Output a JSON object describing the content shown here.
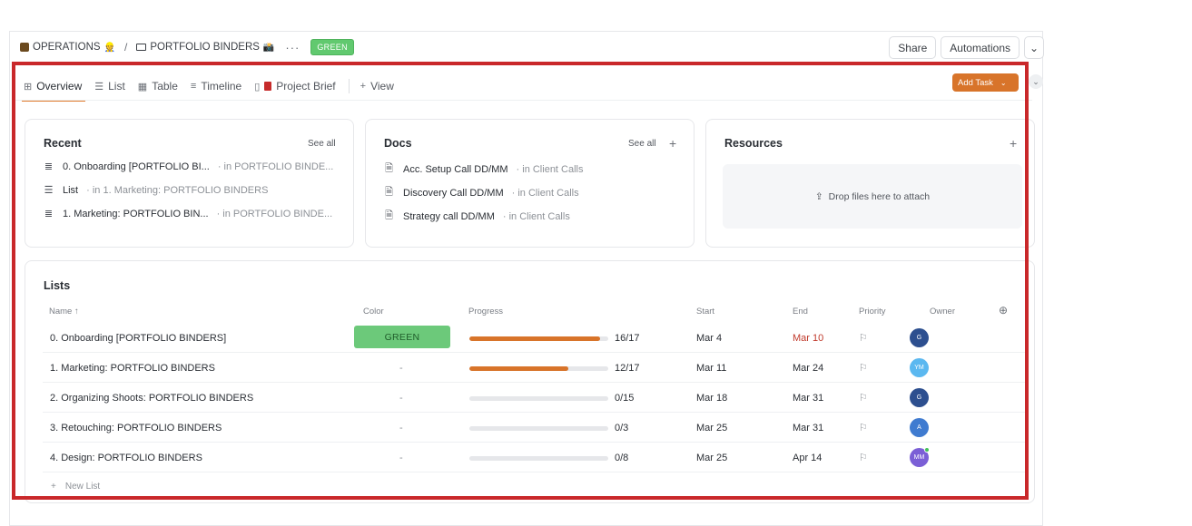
{
  "breadcrumb": {
    "space": "OPERATIONS",
    "space_emoji": "👷",
    "separator": "/",
    "folder": "PORTFOLIO BINDERS",
    "folder_emoji": "📸",
    "more": "···",
    "status": "GREEN"
  },
  "header_actions": {
    "share": "Share",
    "automations": "Automations",
    "chevron": "⌄"
  },
  "tabs": [
    {
      "label": "Overview",
      "icon": "overview-icon",
      "glyph": "⊞"
    },
    {
      "label": "List",
      "icon": "list-icon",
      "glyph": "☰"
    },
    {
      "label": "Table",
      "icon": "table-icon",
      "glyph": "▦"
    },
    {
      "label": "Timeline",
      "icon": "timeline-icon",
      "glyph": "≡"
    },
    {
      "label": "Project Brief",
      "icon": "doc-icon",
      "glyph": "▯"
    },
    {
      "label": "View",
      "icon": "plus-icon",
      "glyph": "+"
    }
  ],
  "add_task": {
    "label": "Add Task",
    "chevron": "⌄"
  },
  "recent": {
    "title": "Recent",
    "see_all": "See all",
    "items": [
      {
        "icon": "doc-lines-icon",
        "glyph": "≣",
        "name": "0. Onboarding [PORTFOLIO BI...",
        "location": "· in PORTFOLIO BINDE..."
      },
      {
        "icon": "list-icon",
        "glyph": "☰",
        "name": "List",
        "location": "· in 1. Marketing: PORTFOLIO BINDERS"
      },
      {
        "icon": "doc-lines-icon",
        "glyph": "≣",
        "name": "1. Marketing: PORTFOLIO BIN...",
        "location": "· in PORTFOLIO BINDE..."
      }
    ]
  },
  "docs": {
    "title": "Docs",
    "see_all": "See all",
    "plus": "+",
    "items": [
      {
        "icon": "doc-icon",
        "glyph": "🗎",
        "name": "Acc. Setup Call DD/MM",
        "location": "· in Client Calls"
      },
      {
        "icon": "doc-icon",
        "glyph": "🗎",
        "name": "Discovery Call DD/MM",
        "location": "· in Client Calls"
      },
      {
        "icon": "doc-icon",
        "glyph": "🗎",
        "name": "Strategy call DD/MM",
        "location": "· in Client Calls"
      }
    ]
  },
  "resources": {
    "title": "Resources",
    "plus": "+",
    "drop_text": "Drop files here to attach",
    "upload_glyph": "⇪"
  },
  "lists": {
    "title": "Lists",
    "columns": {
      "name": "Name ↑",
      "color": "Color",
      "progress": "Progress",
      "start": "Start",
      "end": "End",
      "priority": "Priority",
      "owner": "Owner"
    },
    "add_column_glyph": "⊕",
    "rows": [
      {
        "name": "0. Onboarding [PORTFOLIO BINDERS]",
        "color": "GREEN",
        "progress_text": "16/17",
        "progress": 0.94,
        "start": "Mar 4",
        "end": "Mar 10",
        "end_overdue": true,
        "owner_initials": "G",
        "owner_color": "#2d4f8f",
        "online": false
      },
      {
        "name": "1. Marketing: PORTFOLIO BINDERS",
        "color": "-",
        "progress_text": "12/17",
        "progress": 0.71,
        "start": "Mar 11",
        "end": "Mar 24",
        "end_overdue": false,
        "owner_initials": "YM",
        "owner_color": "#5bb8f0",
        "online": false
      },
      {
        "name": "2. Organizing Shoots: PORTFOLIO BINDERS",
        "color": "-",
        "progress_text": "0/15",
        "progress": 0,
        "start": "Mar 18",
        "end": "Mar 31",
        "end_overdue": false,
        "owner_initials": "G",
        "owner_color": "#2d4f8f",
        "online": false
      },
      {
        "name": "3. Retouching: PORTFOLIO BINDERS",
        "color": "-",
        "progress_text": "0/3",
        "progress": 0,
        "start": "Mar 25",
        "end": "Mar 31",
        "end_overdue": false,
        "owner_initials": "A",
        "owner_color": "#3f7bd0",
        "online": false
      },
      {
        "name": "4. Design: PORTFOLIO BINDERS",
        "color": "-",
        "progress_text": "0/8",
        "progress": 0,
        "start": "Mar 25",
        "end": "Apr 14",
        "end_overdue": false,
        "owner_initials": "MM",
        "owner_color": "#7b5fd6",
        "online": true
      }
    ],
    "new_list": "New List",
    "new_list_glyph": "+"
  },
  "flag_glyph": "⚐"
}
